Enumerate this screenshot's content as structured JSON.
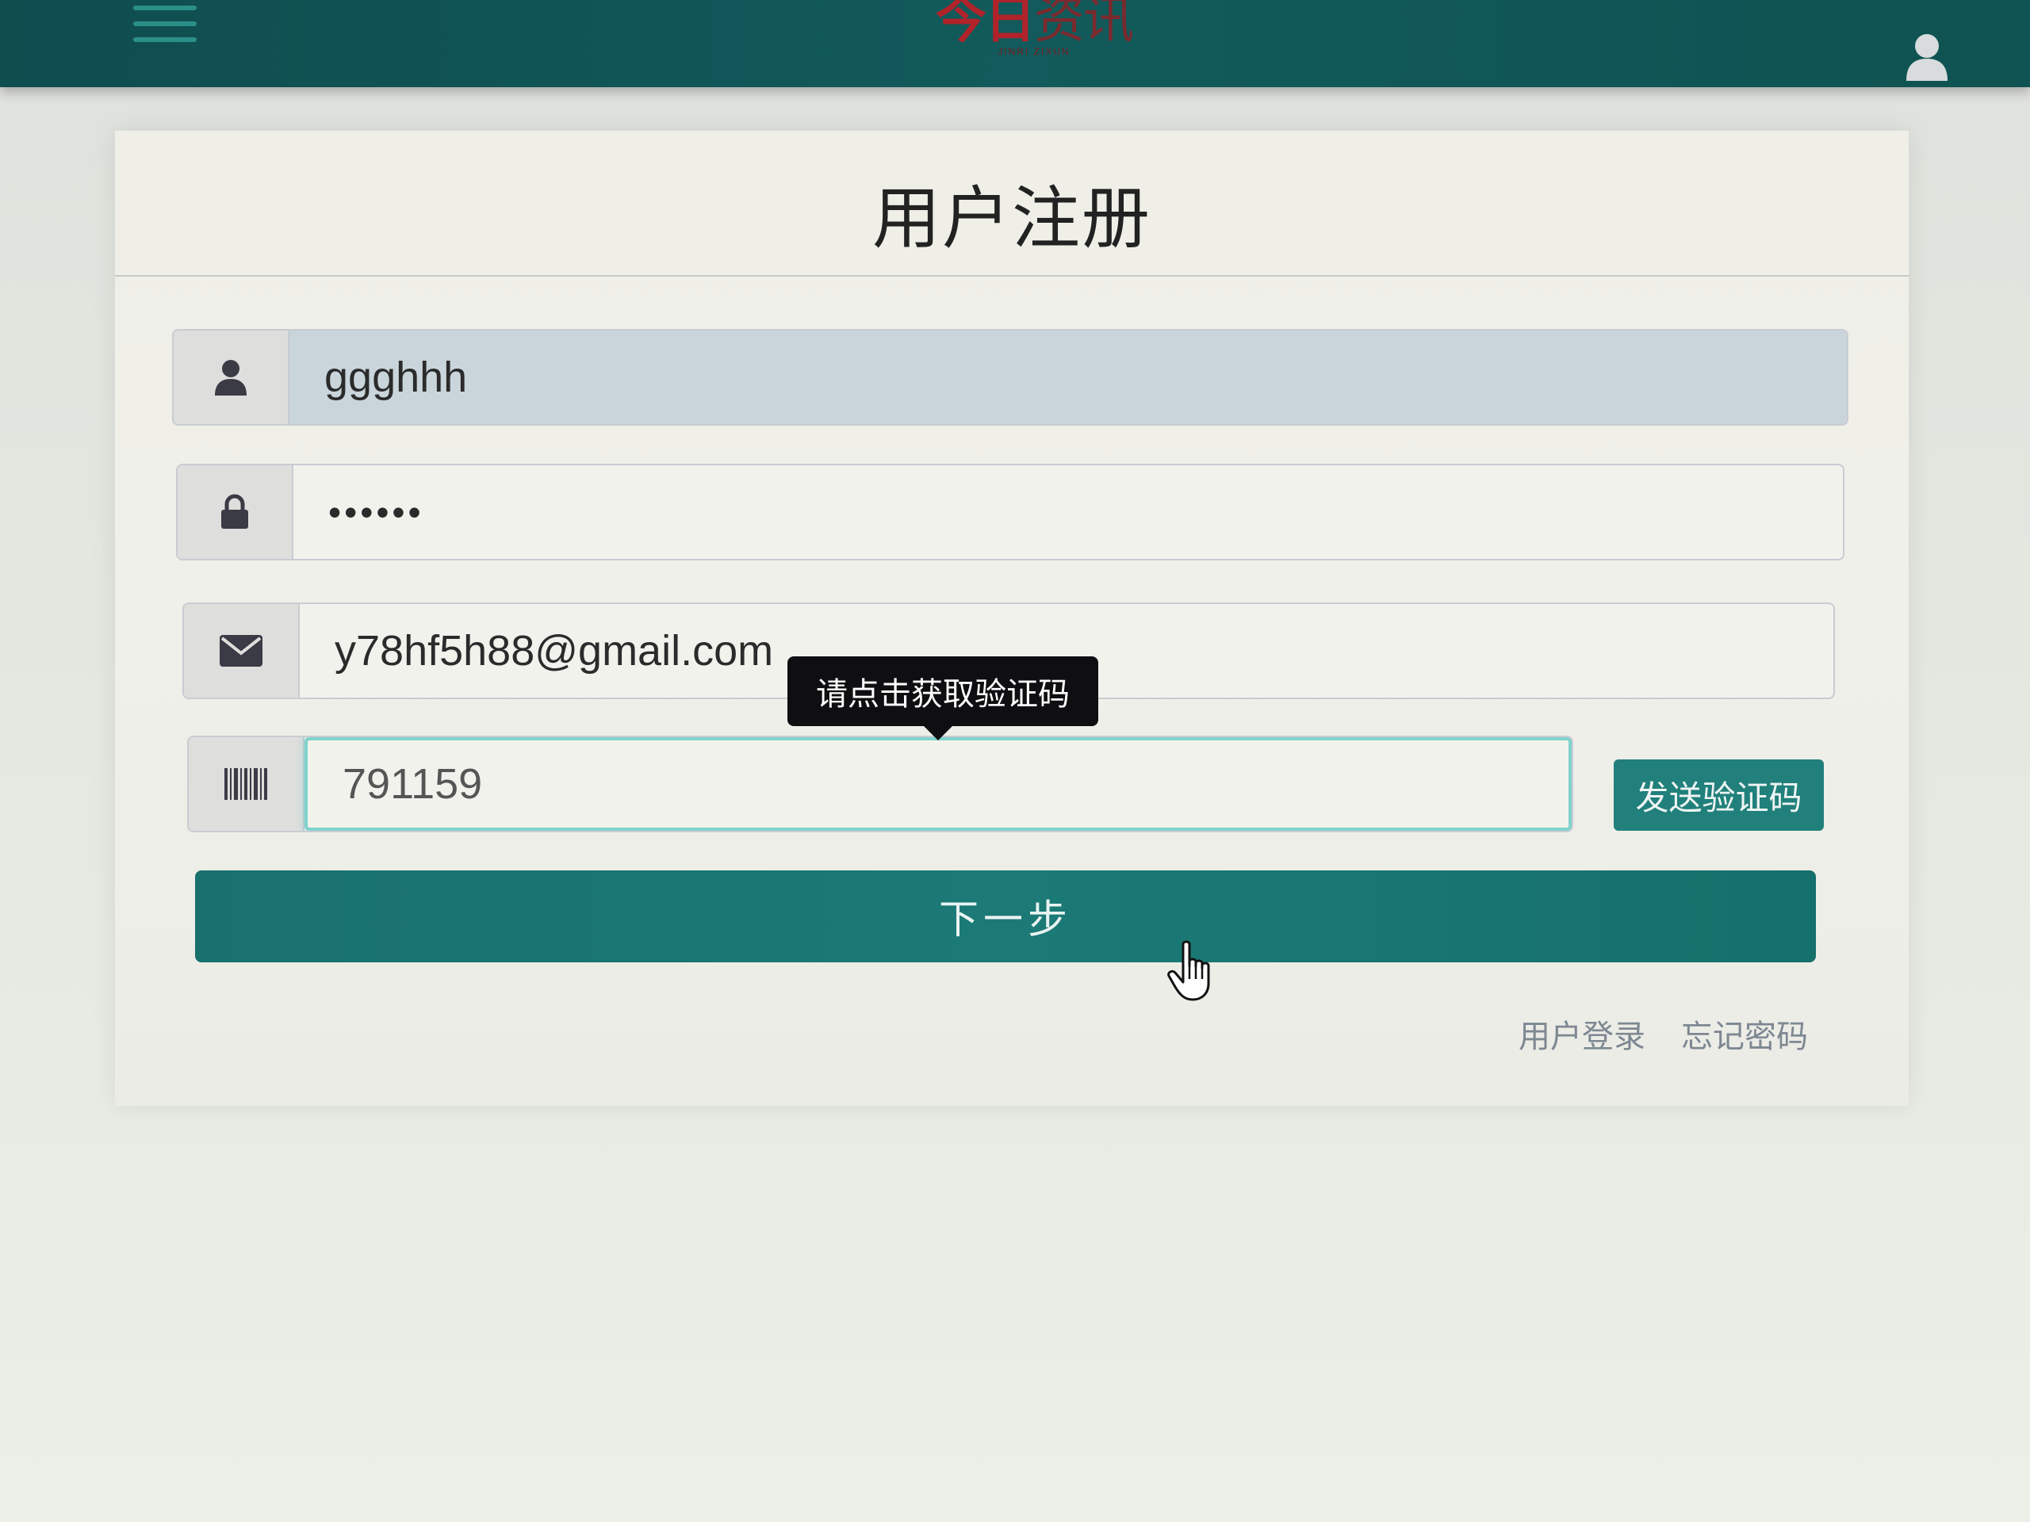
{
  "header": {
    "logo_text": "今日",
    "logo_text_alt": "资讯",
    "logo_subtitle": "JINRI ZIXUN"
  },
  "form": {
    "title": "用户注册",
    "username_value": "ggghhh",
    "password_value": "••••••",
    "email_value": "y78hf5h88@gmail.com",
    "code_value": "791159",
    "tooltip": "请点击获取验证码",
    "send_code_label": "发送验证码",
    "next_label": "下一步",
    "login_link": "用户登录",
    "forgot_link": "忘记密码"
  },
  "colors": {
    "navbar": "#125a5b",
    "primary": "#1b7a76",
    "focus_border": "#7fd3cc",
    "logo_red": "#b1232a"
  },
  "icons": {
    "menu": "hamburger-icon",
    "user_top": "user-icon",
    "username": "user-icon",
    "password": "lock-icon",
    "email": "envelope-icon",
    "code": "barcode-icon",
    "cursor": "hand-pointer-icon"
  }
}
